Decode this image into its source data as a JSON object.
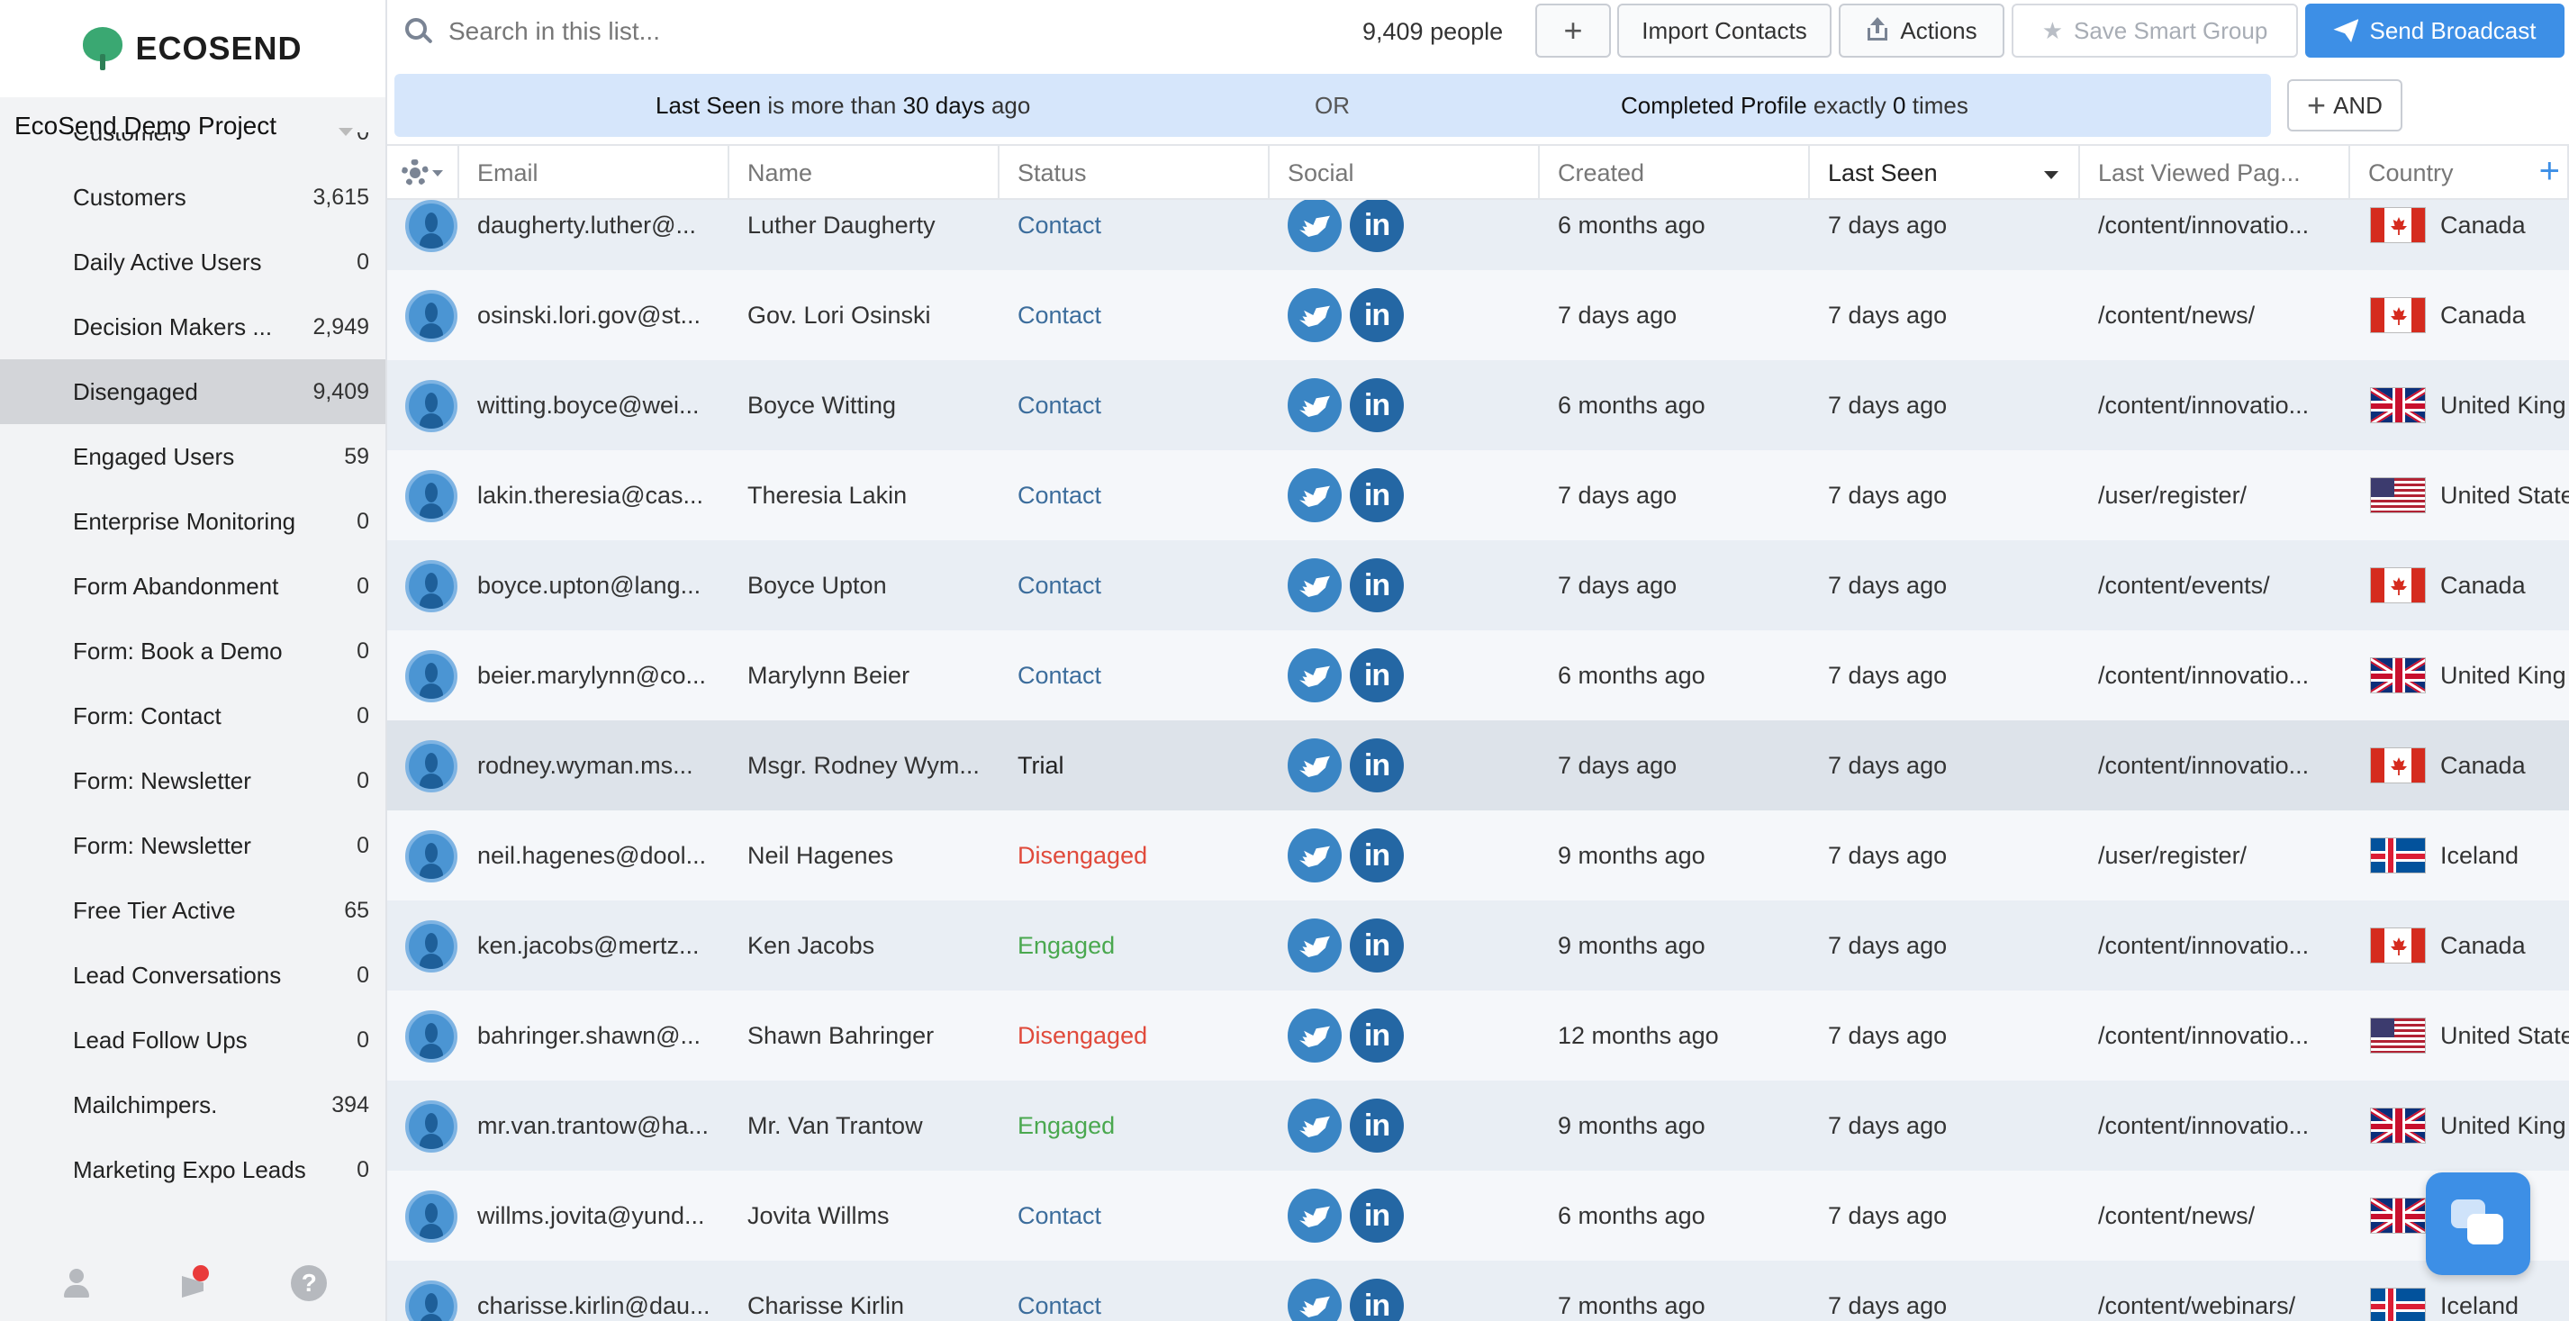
{
  "brand": {
    "name": "ECOSEND"
  },
  "project": {
    "name": "EcoSend Demo Project"
  },
  "sidebar": {
    "groups": [
      {
        "label": "Customers",
        "count": "0"
      },
      {
        "label": "Customers",
        "count": "3,615"
      },
      {
        "label": "Daily Active Users",
        "count": "0"
      },
      {
        "label": "Decision Makers ...",
        "count": "2,949"
      },
      {
        "label": "Disengaged",
        "count": "9,409",
        "active": true
      },
      {
        "label": "Engaged Users",
        "count": "59"
      },
      {
        "label": "Enterprise Monitoring",
        "count": "0"
      },
      {
        "label": "Form Abandonment",
        "count": "0"
      },
      {
        "label": "Form: Book a Demo",
        "count": "0"
      },
      {
        "label": "Form: Contact",
        "count": "0"
      },
      {
        "label": "Form: Newsletter",
        "count": "0"
      },
      {
        "label": "Form: Newsletter",
        "count": "0"
      },
      {
        "label": "Free Tier Active",
        "count": "65"
      },
      {
        "label": "Lead Conversations",
        "count": "0"
      },
      {
        "label": "Lead Follow Ups",
        "count": "0"
      },
      {
        "label": "Mailchimpers.",
        "count": "394"
      },
      {
        "label": "Marketing Expo Leads",
        "count": "0"
      }
    ],
    "footer_icons": [
      "user-icon",
      "notification-icon",
      "help-icon"
    ],
    "help_glyph": "?"
  },
  "search": {
    "placeholder": "Search in this list..."
  },
  "toolbar": {
    "people_count": "9,409 people",
    "add_label": "+",
    "import_label": "Import Contacts",
    "actions_label": "Actions",
    "save_smart_group_label": "Save Smart Group",
    "send_broadcast_label": "Send Broadcast"
  },
  "filters": {
    "conditions": [
      {
        "field": "Last Seen",
        "op": "is more than",
        "value": "30 days",
        "suffix": "ago"
      },
      {
        "field": "Completed Profile",
        "op": "exactly",
        "value": "0",
        "suffix": "times"
      }
    ],
    "or_label": "OR",
    "and_label": "AND"
  },
  "table": {
    "columns": [
      "Email",
      "Name",
      "Status",
      "Social",
      "Created",
      "Last Seen",
      "Last Viewed Pag...",
      "Country"
    ],
    "sorted_column": "Last Seen",
    "rows": [
      {
        "email": "daugherty.luther@...",
        "name": "Luther Daugherty",
        "status": "Contact",
        "created": "6 months ago",
        "last_seen": "7 days ago",
        "page": "/content/innovatio...",
        "country": "Canada",
        "flag": "canada"
      },
      {
        "email": "osinski.lori.gov@st...",
        "name": "Gov. Lori Osinski",
        "status": "Contact",
        "created": "7 days ago",
        "last_seen": "7 days ago",
        "page": "/content/news/",
        "country": "Canada",
        "flag": "canada"
      },
      {
        "email": "witting.boyce@wei...",
        "name": "Boyce Witting",
        "status": "Contact",
        "created": "6 months ago",
        "last_seen": "7 days ago",
        "page": "/content/innovatio...",
        "country": "United King",
        "flag": "uk"
      },
      {
        "email": "lakin.theresia@cas...",
        "name": "Theresia Lakin",
        "status": "Contact",
        "created": "7 days ago",
        "last_seen": "7 days ago",
        "page": "/user/register/",
        "country": "United State",
        "flag": "usa"
      },
      {
        "email": "boyce.upton@lang...",
        "name": "Boyce Upton",
        "status": "Contact",
        "created": "7 days ago",
        "last_seen": "7 days ago",
        "page": "/content/events/",
        "country": "Canada",
        "flag": "canada"
      },
      {
        "email": "beier.marylynn@co...",
        "name": "Marylynn Beier",
        "status": "Contact",
        "created": "6 months ago",
        "last_seen": "7 days ago",
        "page": "/content/innovatio...",
        "country": "United King",
        "flag": "uk"
      },
      {
        "email": "rodney.wyman.ms...",
        "name": "Msgr. Rodney Wym...",
        "status": "Trial",
        "created": "7 days ago",
        "last_seen": "7 days ago",
        "page": "/content/innovatio...",
        "country": "Canada",
        "flag": "canada",
        "active": true
      },
      {
        "email": "neil.hagenes@dool...",
        "name": "Neil Hagenes",
        "status": "Disengaged",
        "created": "9 months ago",
        "last_seen": "7 days ago",
        "page": "/user/register/",
        "country": "Iceland",
        "flag": "iceland"
      },
      {
        "email": "ken.jacobs@mertz...",
        "name": "Ken Jacobs",
        "status": "Engaged",
        "created": "9 months ago",
        "last_seen": "7 days ago",
        "page": "/content/innovatio...",
        "country": "Canada",
        "flag": "canada"
      },
      {
        "email": "bahringer.shawn@...",
        "name": "Shawn Bahringer",
        "status": "Disengaged",
        "created": "12 months ago",
        "last_seen": "7 days ago",
        "page": "/content/innovatio...",
        "country": "United State",
        "flag": "usa"
      },
      {
        "email": "mr.van.trantow@ha...",
        "name": "Mr. Van Trantow",
        "status": "Engaged",
        "created": "9 months ago",
        "last_seen": "7 days ago",
        "page": "/content/innovatio...",
        "country": "United King",
        "flag": "uk"
      },
      {
        "email": "willms.jovita@yund...",
        "name": "Jovita Willms",
        "status": "Contact",
        "created": "6 months ago",
        "last_seen": "7 days ago",
        "page": "/content/news/",
        "country": "King",
        "flag": "uk"
      },
      {
        "email": "charisse.kirlin@dau...",
        "name": "Charisse Kirlin",
        "status": "Contact",
        "created": "7 months ago",
        "last_seen": "7 days ago",
        "page": "/content/webinars/",
        "country": "Iceland",
        "flag": "iceland"
      }
    ],
    "linkedin_glyph": "in"
  },
  "colors": {
    "accent": "#3d8fe6",
    "filter_bg": "#d6e6fb",
    "status_contact": "#3c6d9c",
    "status_disengaged": "#e04a3b",
    "status_engaged": "#4aa84f"
  }
}
